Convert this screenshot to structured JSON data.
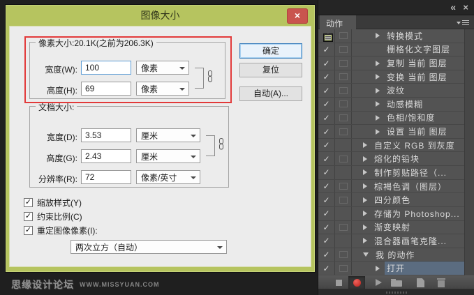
{
  "icons": {
    "close": "×",
    "check": "✓",
    "collapse": "«"
  },
  "colors": {
    "titlebar_green": "#b6c45f",
    "close_red": "#c9544e",
    "annotation_red": "#e23a3a",
    "selection_blue": "#5b6c80",
    "record_red": "#cc2f2a"
  },
  "dialog": {
    "title": "图像大小",
    "pixel_group": {
      "legend": "像素大小:20.1K(之前为206.3K)",
      "width_label": "宽度(W):",
      "width_value": "100",
      "width_unit": "像素",
      "height_label": "高度(H):",
      "height_value": "69",
      "height_unit": "像素"
    },
    "doc_group": {
      "legend": "文档大小:",
      "width_label": "宽度(D):",
      "width_value": "3.53",
      "width_unit": "厘米",
      "height_label": "高度(G):",
      "height_value": "2.43",
      "height_unit": "厘米",
      "resolution_label": "分辨率(R):",
      "resolution_value": "72",
      "resolution_unit": "像素/英寸"
    },
    "options": [
      {
        "label": "缩放样式(Y)",
        "checked": true
      },
      {
        "label": "约束比例(C)",
        "checked": true
      },
      {
        "label": "重定图像像素(I):",
        "checked": true
      }
    ],
    "resample_value": "两次立方（自动）",
    "buttons": {
      "ok": "确定",
      "reset": "复位",
      "auto": "自动(A)..."
    }
  },
  "watermark": {
    "brand": "思缘设计论坛",
    "site": "WWW.MISSYUAN.COM"
  },
  "actions_panel": {
    "tab_label": "动作",
    "rows": [
      {
        "label": "转换模式",
        "level": "step",
        "arrow": "right",
        "modal": "empty",
        "checked": true,
        "selected": false
      },
      {
        "label": "栅格化文字图层",
        "level": "step",
        "arrow": "none",
        "modal": "empty",
        "checked": true,
        "selected": false
      },
      {
        "label": "复制 当前 图层",
        "level": "step",
        "arrow": "right",
        "modal": "empty",
        "checked": true,
        "selected": false
      },
      {
        "label": "变换 当前 图层",
        "level": "step",
        "arrow": "right",
        "modal": "empty",
        "checked": true,
        "selected": false
      },
      {
        "label": "波纹",
        "level": "step",
        "arrow": "right",
        "modal": "empty",
        "checked": true,
        "selected": false
      },
      {
        "label": "动感模糊",
        "level": "step",
        "arrow": "right",
        "modal": "empty",
        "checked": true,
        "selected": false
      },
      {
        "label": "色相/饱和度",
        "level": "step",
        "arrow": "right",
        "modal": "empty",
        "checked": true,
        "selected": false
      },
      {
        "label": "设置 当前 图层",
        "level": "step",
        "arrow": "right",
        "modal": "empty",
        "checked": true,
        "selected": false
      },
      {
        "label": "自定义 RGB 到灰度",
        "level": "action",
        "arrow": "right",
        "modal": "dialog",
        "checked": true,
        "selected": false
      },
      {
        "label": "熔化的铅块",
        "level": "action",
        "arrow": "right",
        "modal": "empty",
        "checked": true,
        "selected": false
      },
      {
        "label": "制作剪贴路径（...",
        "level": "action",
        "arrow": "right",
        "modal": "dialog",
        "checked": true,
        "selected": false
      },
      {
        "label": "棕褐色调（图层）",
        "level": "action",
        "arrow": "right",
        "modal": "empty",
        "checked": true,
        "selected": false
      },
      {
        "label": "四分颜色",
        "level": "action",
        "arrow": "right",
        "modal": "empty",
        "checked": true,
        "selected": false
      },
      {
        "label": "存储为 Photoshop...",
        "level": "action",
        "arrow": "right",
        "modal": "dialog",
        "checked": true,
        "selected": false
      },
      {
        "label": "渐变映射",
        "level": "action",
        "arrow": "right",
        "modal": "empty",
        "checked": true,
        "selected": false
      },
      {
        "label": "混合器画笔克隆...",
        "level": "action",
        "arrow": "right",
        "modal": "dialog",
        "checked": true,
        "selected": false
      },
      {
        "label": "我 的动作",
        "level": "action",
        "arrow": "down",
        "modal": "empty",
        "checked": true,
        "selected": false
      },
      {
        "label": "打开",
        "level": "step",
        "arrow": "right",
        "modal": "empty",
        "checked": true,
        "selected": true
      }
    ]
  }
}
